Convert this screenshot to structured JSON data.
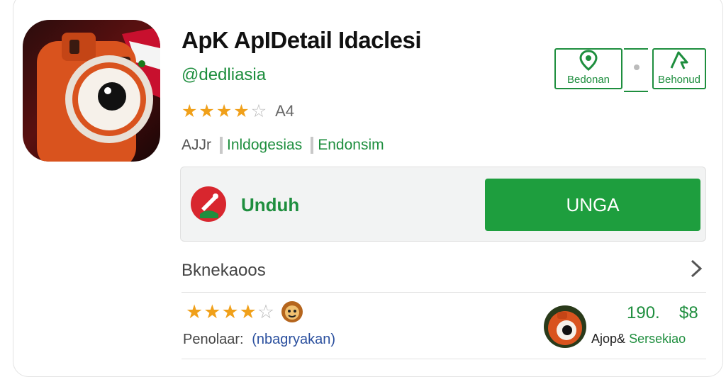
{
  "app": {
    "title": "ApK ApIDetail Idaclesi",
    "developer": "@dedliasia",
    "rating": {
      "stars": 4,
      "max": 5,
      "count_text": "A4"
    },
    "meta": {
      "a": "AJJr",
      "b": "Inldogesias",
      "c": "Endonsim"
    }
  },
  "actions": {
    "left_label": "Bedonan",
    "right_label": "Behonud"
  },
  "download": {
    "label": "Unduh",
    "install_label": "UNGA"
  },
  "section": {
    "title": "Bknekaoos"
  },
  "review": {
    "stars": 4,
    "max": 5,
    "meta_label": "Penolaar:",
    "meta_link": "(nbagryakan)"
  },
  "side": {
    "value1": "190.",
    "value2": "$8",
    "caption_a": "Ajop&",
    "caption_b": "Sersekiao"
  },
  "colors": {
    "accent": "#1e8e3e",
    "button": "#1e9e3e",
    "star": "#f0a01a"
  }
}
